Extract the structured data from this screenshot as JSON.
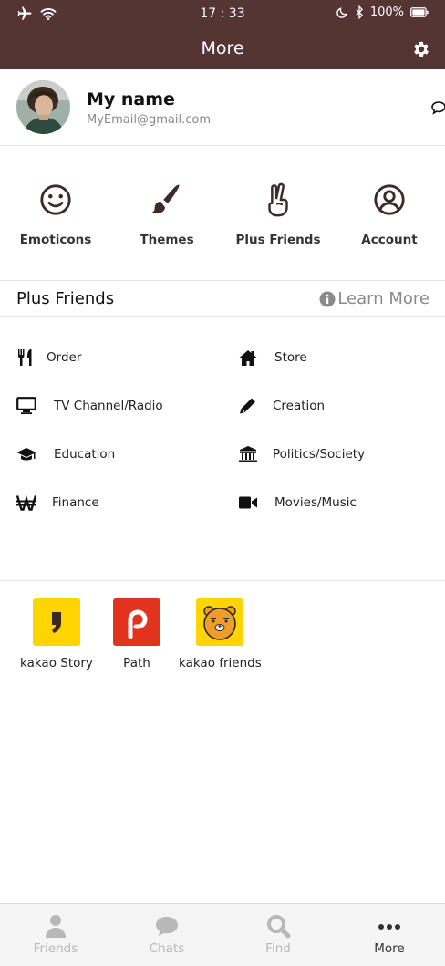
{
  "status_bar": {
    "time": "17 : 33",
    "battery": "100%"
  },
  "header": {
    "title": "More"
  },
  "profile": {
    "name": "My name",
    "email": "MyEmail@gmail.com"
  },
  "shortcuts": [
    {
      "label": "Emoticons",
      "icon": "smile-icon"
    },
    {
      "label": "Themes",
      "icon": "brush-icon"
    },
    {
      "label": "Plus Friends",
      "icon": "hand-peace-icon"
    },
    {
      "label": "Account",
      "icon": "user-circle-icon"
    }
  ],
  "plus_friends": {
    "title": "Plus Friends",
    "learn_more": "Learn More",
    "items": [
      {
        "label": "Order",
        "icon": "utensils-icon"
      },
      {
        "label": "Store",
        "icon": "home-icon"
      },
      {
        "label": "TV Channel/Radio",
        "icon": "desktop-icon"
      },
      {
        "label": "Creation",
        "icon": "pencil-icon"
      },
      {
        "label": "Education",
        "icon": "graduation-cap-icon"
      },
      {
        "label": "Politics/Society",
        "icon": "bank-icon"
      },
      {
        "label": "Finance",
        "icon": "won-icon"
      },
      {
        "label": "Movies/Music",
        "icon": "video-camera-icon"
      }
    ]
  },
  "apps": [
    {
      "label": "kakao Story",
      "color": "#ffd400"
    },
    {
      "label": "Path",
      "color": "#e2331f"
    },
    {
      "label": "kakao friends",
      "color": "#ffd400"
    }
  ],
  "bottom_nav": {
    "tabs": [
      {
        "label": "Friends",
        "icon": "user-icon",
        "active": false
      },
      {
        "label": "Chats",
        "icon": "comment-icon",
        "active": false
      },
      {
        "label": "Find",
        "icon": "search-icon",
        "active": false
      },
      {
        "label": "More",
        "icon": "ellipsis-icon",
        "active": true
      }
    ]
  },
  "colors": {
    "header_bg": "#553434",
    "icon_dark": "#3d2a2a",
    "inactive_tab": "#b8b8b8"
  }
}
